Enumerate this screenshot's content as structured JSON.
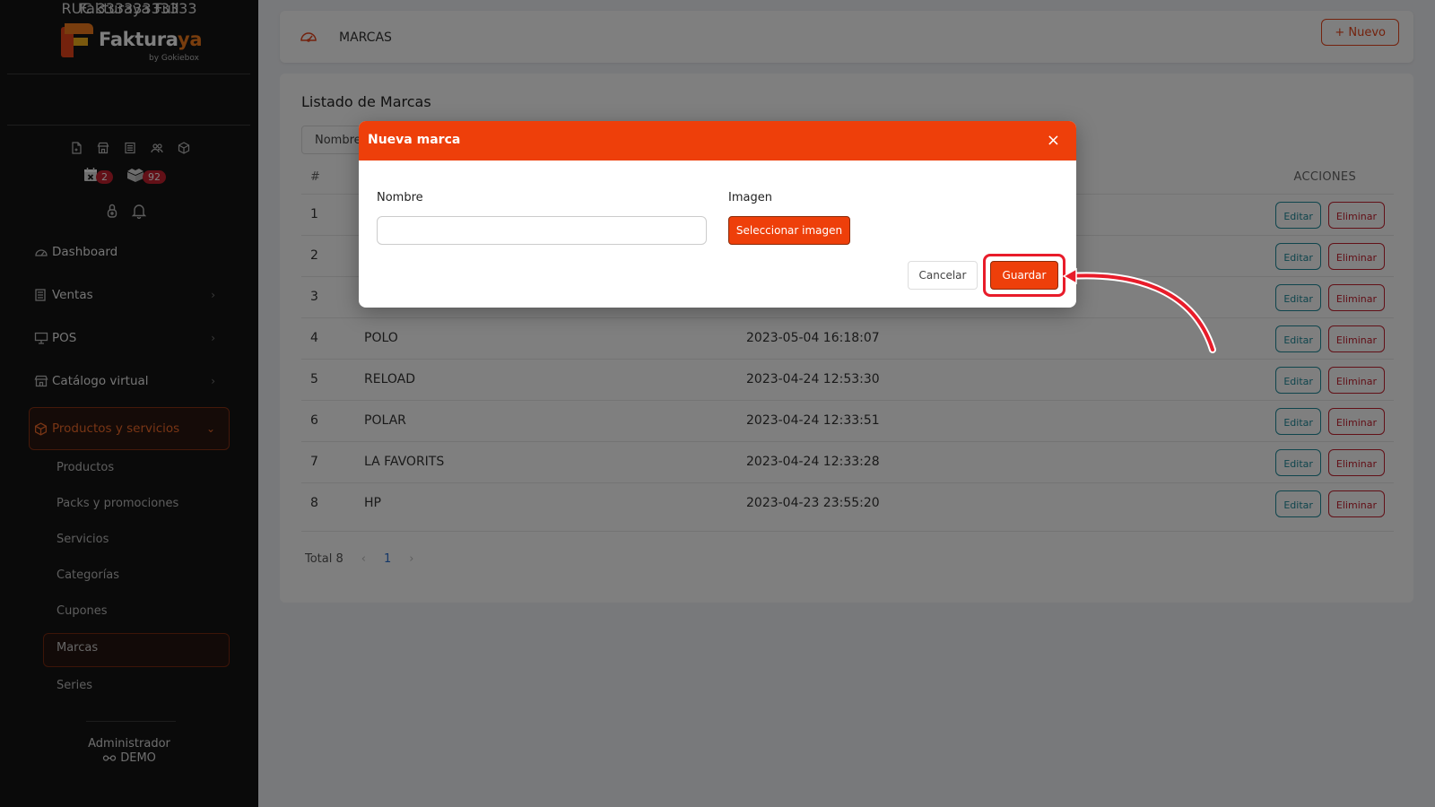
{
  "brand": {
    "name_main": "Faktura",
    "name_accent": "ya",
    "sub": "by Gokiebox"
  },
  "company": {
    "name": "Fakturaya Full",
    "ruc": "RUC 33333333333"
  },
  "badges": {
    "calendar": "2",
    "boxes": "92"
  },
  "sidebar": {
    "items": [
      {
        "label": "Dashboard"
      },
      {
        "label": "Ventas"
      },
      {
        "label": "POS"
      },
      {
        "label": "Catálogo virtual"
      },
      {
        "label": "Productos y servicios"
      }
    ],
    "subitems": [
      {
        "label": "Productos"
      },
      {
        "label": "Packs y promociones"
      },
      {
        "label": "Servicios"
      },
      {
        "label": "Categorías"
      },
      {
        "label": "Cupones"
      },
      {
        "label": "Marcas"
      },
      {
        "label": "Series"
      }
    ],
    "user": {
      "role": "Administrador",
      "name": "DEMO"
    }
  },
  "header": {
    "title": "MARCAS",
    "new_button": "+ Nuevo"
  },
  "list": {
    "title": "Listado de Marcas",
    "filter_label": "Nombre",
    "col_num": "#",
    "col_actions": "ACCIONES",
    "edit_label": "Editar",
    "delete_label": "Eliminar",
    "rows": [
      {
        "num": "1",
        "name": "",
        "date": ""
      },
      {
        "num": "2",
        "name": "",
        "date": ""
      },
      {
        "num": "3",
        "name": "",
        "date": ""
      },
      {
        "num": "4",
        "name": "POLO",
        "date": "2023-05-04 16:18:07"
      },
      {
        "num": "5",
        "name": "RELOAD",
        "date": "2023-04-24 12:53:30"
      },
      {
        "num": "6",
        "name": "POLAR",
        "date": "2023-04-24 12:33:51"
      },
      {
        "num": "7",
        "name": "LA FAVORITS",
        "date": "2023-04-24 12:33:28"
      },
      {
        "num": "8",
        "name": "HP",
        "date": "2023-04-23 23:55:20"
      }
    ],
    "total": "Total 8",
    "page": "1",
    "prev": "‹",
    "next": "›"
  },
  "modal": {
    "title": "Nueva marca",
    "close": "×",
    "name_label": "Nombre",
    "name_value": "",
    "image_label": "Imagen",
    "select_image": "Seleccionar imagen",
    "cancel": "Cancelar",
    "save": "Guardar"
  },
  "colors": {
    "accent": "#ee3f0a",
    "sidebar_bg": "#141414",
    "danger": "#c4202e",
    "teal": "#1f8a9a",
    "highlight": "#e81c2a"
  }
}
